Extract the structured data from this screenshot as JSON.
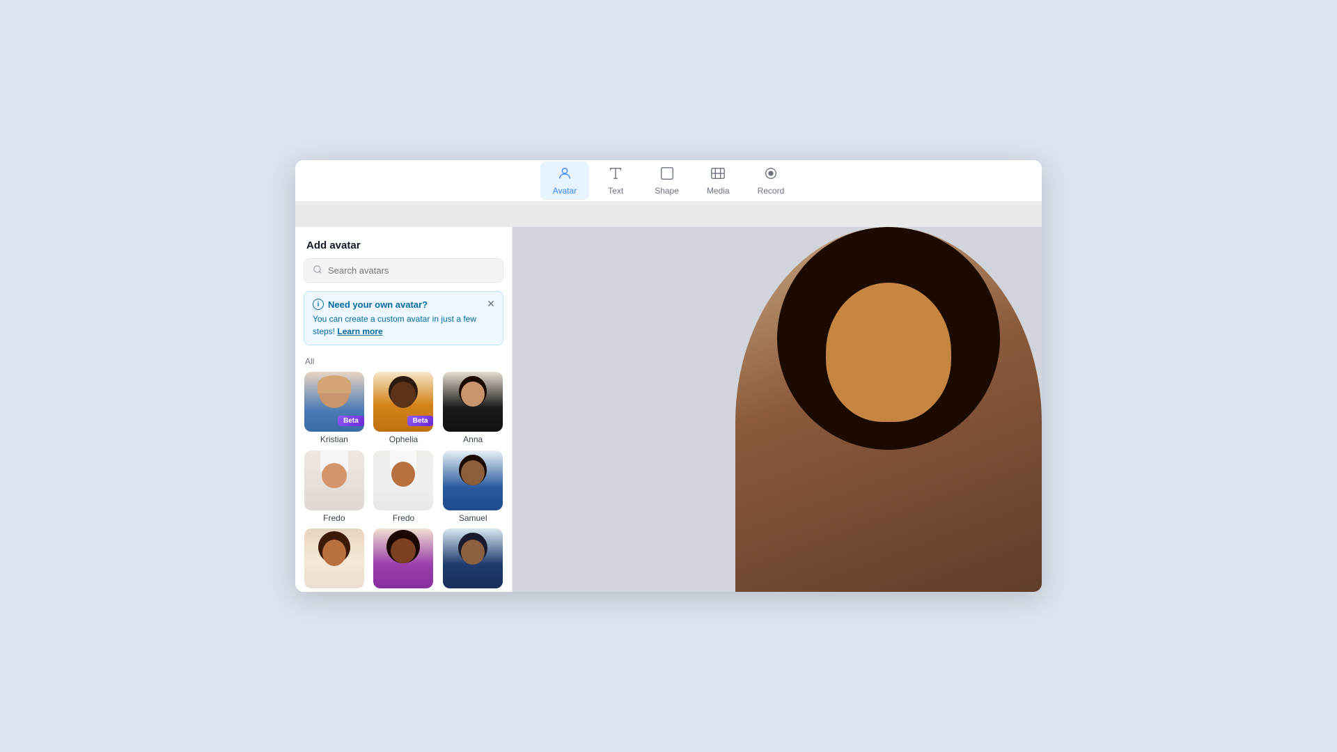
{
  "toolbar": {
    "items": [
      {
        "id": "avatar",
        "label": "Avatar",
        "active": true
      },
      {
        "id": "text",
        "label": "Text",
        "active": false
      },
      {
        "id": "shape",
        "label": "Shape",
        "active": false
      },
      {
        "id": "media",
        "label": "Media",
        "active": false
      },
      {
        "id": "record",
        "label": "Record",
        "active": false
      }
    ]
  },
  "panel": {
    "title": "Add avatar",
    "search": {
      "placeholder": "Search avatars"
    },
    "banner": {
      "title": "Need your own avatar?",
      "body": "You can create a custom avatar in just a few steps!",
      "link": "Learn more"
    },
    "section": "All",
    "avatars": [
      {
        "id": "kristian",
        "name": "Kristian",
        "beta": true,
        "row": 1
      },
      {
        "id": "ophelia",
        "name": "Ophelia",
        "beta": true,
        "row": 1
      },
      {
        "id": "anna",
        "name": "Anna",
        "beta": false,
        "row": 1
      },
      {
        "id": "fredo1",
        "name": "Fredo",
        "beta": false,
        "row": 2
      },
      {
        "id": "fredo2",
        "name": "Fredo",
        "beta": false,
        "row": 2
      },
      {
        "id": "samuel",
        "name": "Samuel",
        "beta": false,
        "row": 2
      },
      {
        "id": "r3a",
        "name": "",
        "beta": false,
        "row": 3
      },
      {
        "id": "r3b",
        "name": "",
        "beta": false,
        "row": 3
      },
      {
        "id": "r3c",
        "name": "",
        "beta": false,
        "row": 3
      }
    ]
  },
  "colors": {
    "accent": "#3b82f6",
    "active_bg": "#e8f4fd",
    "beta_bg": "#7c3aed",
    "banner_bg": "#eff8ff",
    "banner_border": "#bae6fd"
  }
}
